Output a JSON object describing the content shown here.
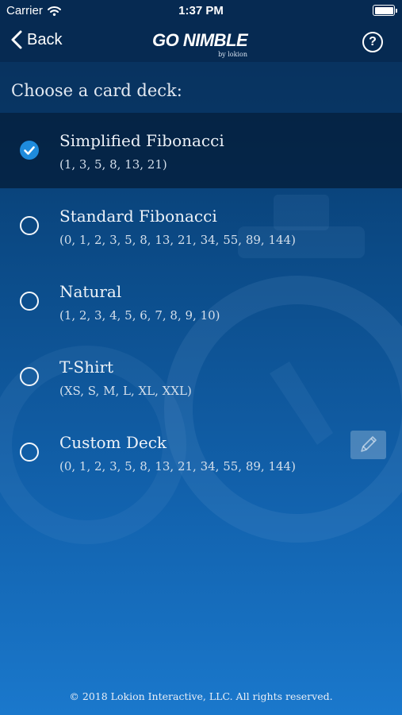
{
  "status_bar": {
    "carrier": "Carrier",
    "time": "1:37 PM",
    "battery_level": 1.0
  },
  "nav": {
    "back_label": "Back",
    "logo_text": "GO NIMBLE",
    "logo_sub": "by lokion",
    "help_label": "?"
  },
  "heading": "Choose a card deck:",
  "decks": [
    {
      "name": "Simplified Fibonacci",
      "values": "(1, 3, 5, 8, 13, 21)",
      "selected": true
    },
    {
      "name": "Standard Fibonacci",
      "values": "(0, 1, 2, 3, 5, 8, 13, 21, 34, 55, 89, 144)",
      "selected": false
    },
    {
      "name": "Natural",
      "values": "(1, 2, 3, 4, 5, 6, 7, 8, 9, 10)",
      "selected": false
    },
    {
      "name": "T-Shirt",
      "values": "(XS, S, M, L, XL, XXL)",
      "selected": false
    },
    {
      "name": "Custom Deck",
      "values": "(0, 1, 2, 3, 5, 8, 13, 21, 34, 55, 89, 144)",
      "selected": false,
      "editable": true
    }
  ],
  "footer": "© 2018 Lokion Interactive, LLC. All rights reserved.",
  "colors": {
    "nav_background": "#062a52",
    "selected_row": "#06203f",
    "check_accent": "#1e8bdc",
    "gradient_bottom": "#1a78cc"
  }
}
